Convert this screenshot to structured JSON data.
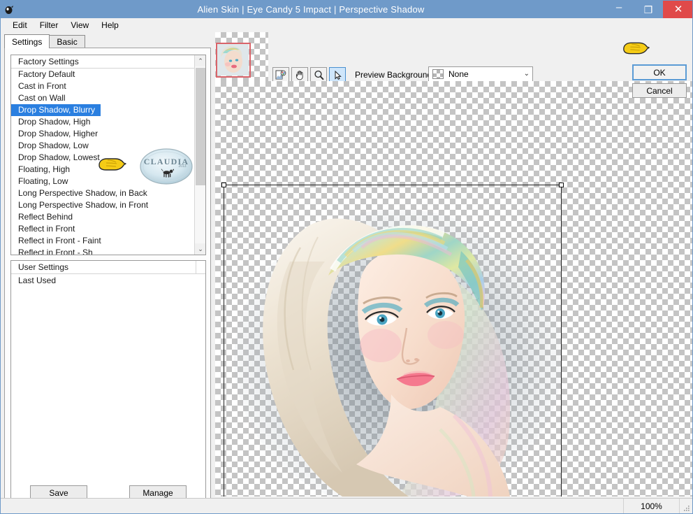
{
  "window": {
    "title": "Alien Skin | Eye Candy 5 Impact | Perspective Shadow",
    "app_icon": "alien-skin-icon",
    "minimize_label": "–",
    "maximize_label": "❐",
    "close_label": "✕",
    "accent_color": "#6f9ac9",
    "close_color": "#e04a4a",
    "selection_color": "#2a7fe0"
  },
  "menubar": {
    "items": [
      {
        "label": "Edit"
      },
      {
        "label": "Filter"
      },
      {
        "label": "View"
      },
      {
        "label": "Help"
      }
    ]
  },
  "tabs": [
    {
      "label": "Settings",
      "active": true
    },
    {
      "label": "Basic",
      "active": false
    }
  ],
  "factory_settings": {
    "header": "Factory Settings",
    "selected": "Drop Shadow, Blurry",
    "items": [
      "Factory Default",
      "Cast in Front",
      "Cast on Wall",
      "Drop Shadow, Blurry",
      "Drop Shadow, High",
      "Drop Shadow, Higher",
      "Drop Shadow, Low",
      "Drop Shadow, Lowest",
      "Floating, High",
      "Floating, Low",
      "Long Perspective Shadow, in Back",
      "Long Perspective Shadow, in Front",
      "Reflect Behind",
      "Reflect in Front",
      "Reflect in Front - Faint",
      "Reflect in Front - Sh"
    ],
    "scroll_up_arrow": "⌃",
    "scroll_down_arrow": "⌄"
  },
  "user_settings": {
    "header": "User Settings",
    "items": [
      "Last Used"
    ]
  },
  "panel_buttons": {
    "save_label": "Save",
    "manage_label": "Manage"
  },
  "toolbar": {
    "tools": [
      {
        "name": "color-sampler-icon",
        "active": false
      },
      {
        "name": "hand-pan-icon",
        "active": false
      },
      {
        "name": "zoom-magnifier-icon",
        "active": false
      },
      {
        "name": "pointer-arrow-icon",
        "active": true
      }
    ]
  },
  "preview_background": {
    "label": "Preview Background:",
    "value": "None",
    "swatch": "checkerboard-swatch",
    "arrow": "⌄"
  },
  "navigator": {
    "name": "navigator-thumbnail",
    "viewport_color": "#d9646a"
  },
  "canvas": {
    "selection": {
      "handles": [
        "top-left-handle",
        "top-right-handle"
      ]
    }
  },
  "dialog_buttons": {
    "ok_label": "OK",
    "cancel_label": "Cancel"
  },
  "statusbar": {
    "message": "",
    "zoom": "100%"
  },
  "watermark": {
    "text": "CLAUDIA",
    "subtext": "2013"
  },
  "annotations": {
    "pointer_list": "yellow-hand-pointer",
    "pointer_ok": "yellow-hand-pointer"
  }
}
